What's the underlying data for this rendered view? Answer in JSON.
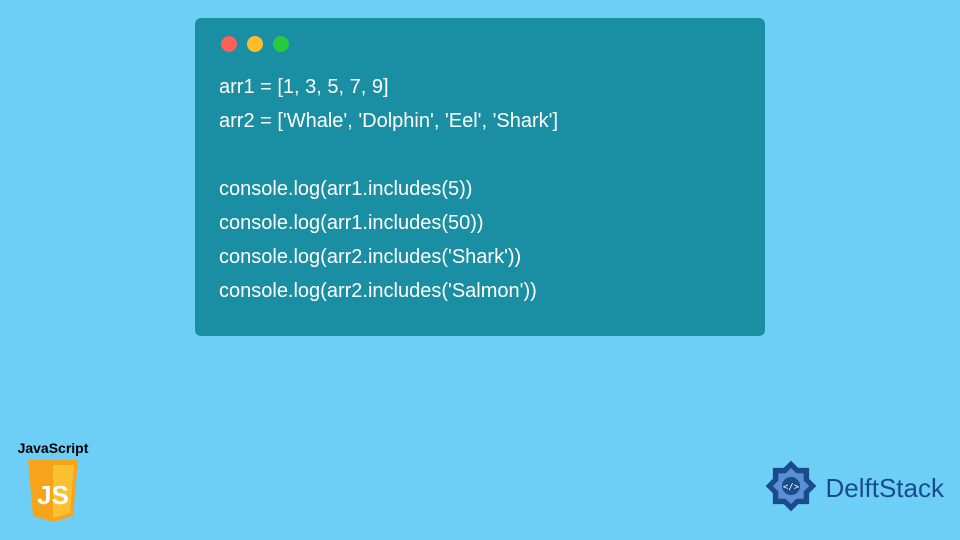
{
  "code": {
    "lines": [
      "arr1 = [1, 3, 5, 7, 9]",
      "arr2 = ['Whale', 'Dolphin', 'Eel', 'Shark']",
      "",
      "console.log(arr1.includes(5))",
      "console.log(arr1.includes(50))",
      "console.log(arr2.includes('Shark'))",
      "console.log(arr2.includes('Salmon'))"
    ]
  },
  "js_badge": {
    "label": "JavaScript",
    "glyph": "JS"
  },
  "brand": {
    "name": "DelftStack"
  },
  "colors": {
    "page_bg": "#6dcff6",
    "window_bg": "#1a8fa3",
    "code_text": "#ffffff",
    "js_shield": "#f7a41d",
    "brand": "#1a4b8c"
  }
}
